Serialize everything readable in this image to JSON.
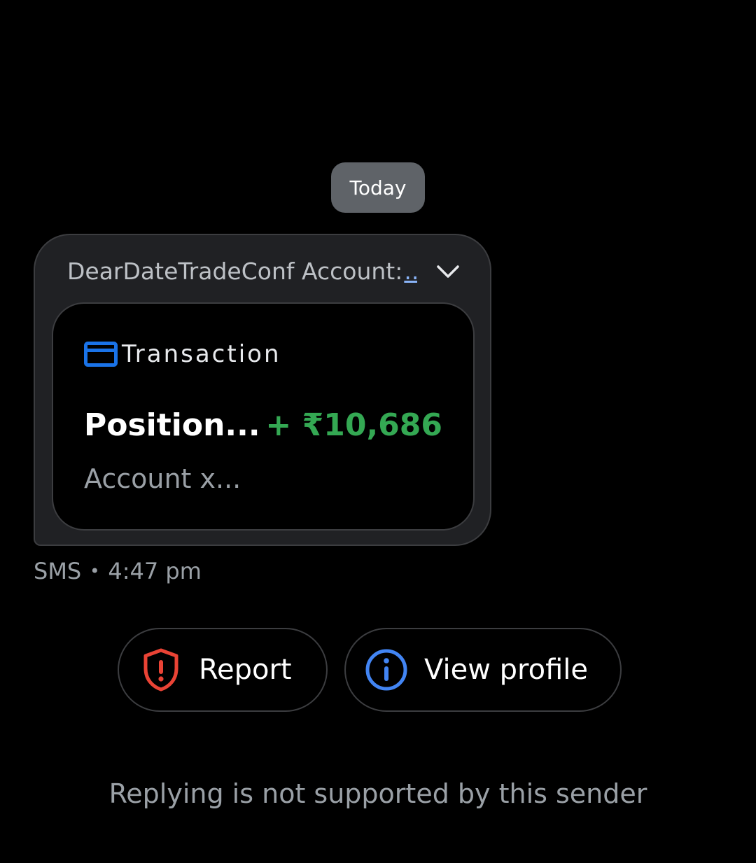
{
  "conversation": {
    "date_divider": "Today",
    "message": {
      "header_text": "DearDateTradeConf Account:",
      "header_more": "...",
      "card": {
        "category_icon": "credit-card-icon",
        "category_label": "Transaction",
        "title": "Position...",
        "amount": "+ ₹10,686",
        "subtitle": "Account x..."
      },
      "channel": "SMS",
      "separator": "•",
      "time": "4:47 pm"
    },
    "actions": [
      {
        "label": "Report",
        "icon": "shield-alert-icon",
        "icon_color": "#ea4335"
      },
      {
        "label": "View profile",
        "icon": "info-icon",
        "icon_color": "#4285f4"
      }
    ],
    "footer_note": "Replying is not supported by this sender"
  },
  "colors": {
    "background": "#000000",
    "bubble": "#202124",
    "chip": "#5f6368",
    "amount": "#34a853",
    "card_icon": "#1a73e8",
    "muted_text": "#9aa0a6"
  }
}
